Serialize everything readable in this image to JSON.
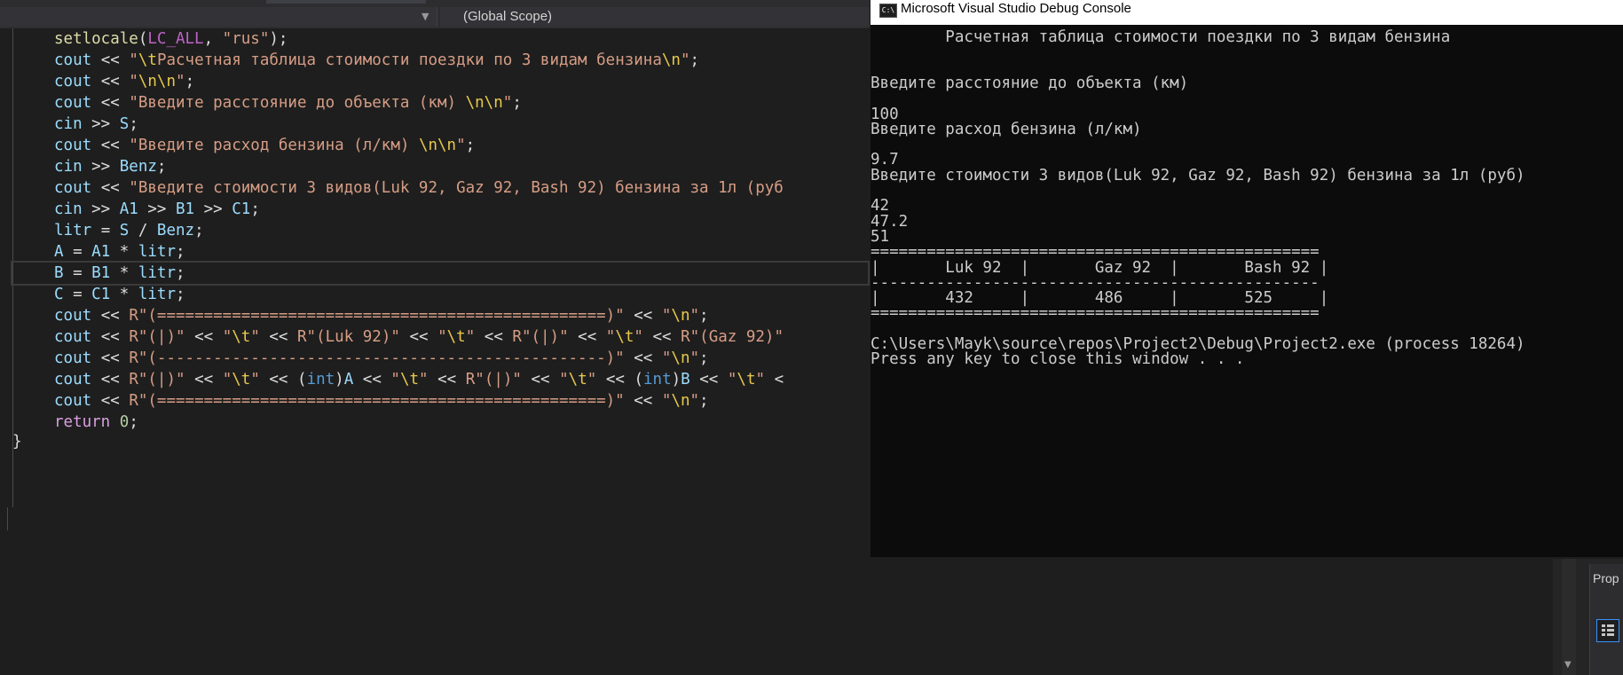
{
  "editor": {
    "navbar": {
      "scope_label": "(Global Scope)"
    },
    "lines": [
      {
        "tokens": [
          {
            "t": "setlocale",
            "c": "fn"
          },
          {
            "t": "("
          },
          {
            "t": "LC_ALL",
            "c": "mac"
          },
          {
            "t": ", "
          },
          {
            "t": "\"rus\"",
            "c": "str"
          },
          {
            "t": ");"
          }
        ]
      },
      {
        "tokens": [
          {
            "t": "cout",
            "c": "var"
          },
          {
            "t": " << "
          },
          {
            "t": "\"",
            "c": "str"
          },
          {
            "t": "\\t",
            "c": "esc"
          },
          {
            "t": "Расчетная таблица стоимости поездки по 3 видам бензина",
            "c": "str"
          },
          {
            "t": "\\n",
            "c": "esc"
          },
          {
            "t": "\"",
            "c": "str"
          },
          {
            "t": ";"
          }
        ]
      },
      {
        "tokens": [
          {
            "t": "cout",
            "c": "var"
          },
          {
            "t": " << "
          },
          {
            "t": "\"",
            "c": "str"
          },
          {
            "t": "\\n\\n",
            "c": "esc"
          },
          {
            "t": "\"",
            "c": "str"
          },
          {
            "t": ";"
          }
        ]
      },
      {
        "tokens": [
          {
            "t": "cout",
            "c": "var"
          },
          {
            "t": " << "
          },
          {
            "t": "\"Введите расстояние до объекта (км) ",
            "c": "str"
          },
          {
            "t": "\\n\\n",
            "c": "esc"
          },
          {
            "t": "\"",
            "c": "str"
          },
          {
            "t": ";"
          }
        ]
      },
      {
        "tokens": [
          {
            "t": "cin",
            "c": "var"
          },
          {
            "t": " >> "
          },
          {
            "t": "S",
            "c": "var"
          },
          {
            "t": ";"
          }
        ]
      },
      {
        "tokens": [
          {
            "t": "cout",
            "c": "var"
          },
          {
            "t": " << "
          },
          {
            "t": "\"Введите расход бензина (л/км) ",
            "c": "str"
          },
          {
            "t": "\\n\\n",
            "c": "esc"
          },
          {
            "t": "\"",
            "c": "str"
          },
          {
            "t": ";"
          }
        ]
      },
      {
        "tokens": [
          {
            "t": "cin",
            "c": "var"
          },
          {
            "t": " >> "
          },
          {
            "t": "Benz",
            "c": "var"
          },
          {
            "t": ";"
          }
        ]
      },
      {
        "tokens": [
          {
            "t": "cout",
            "c": "var"
          },
          {
            "t": " << "
          },
          {
            "t": "\"Введите стоимости 3 видов(Luk 92, Gaz 92, Bash 92) бензина за 1л (руб",
            "c": "str"
          }
        ]
      },
      {
        "tokens": [
          {
            "t": "cin",
            "c": "var"
          },
          {
            "t": " >> "
          },
          {
            "t": "A1",
            "c": "var"
          },
          {
            "t": " >> "
          },
          {
            "t": "B1",
            "c": "var"
          },
          {
            "t": " >> "
          },
          {
            "t": "C1",
            "c": "var"
          },
          {
            "t": ";"
          }
        ]
      },
      {
        "tokens": [
          {
            "t": "litr",
            "c": "var"
          },
          {
            "t": " = "
          },
          {
            "t": "S",
            "c": "var"
          },
          {
            "t": " / "
          },
          {
            "t": "Benz",
            "c": "var"
          },
          {
            "t": ";"
          }
        ]
      },
      {
        "tokens": [
          {
            "t": "A",
            "c": "var"
          },
          {
            "t": " = "
          },
          {
            "t": "A1",
            "c": "var"
          },
          {
            "t": " * "
          },
          {
            "t": "litr",
            "c": "var"
          },
          {
            "t": ";"
          }
        ]
      },
      {
        "current": true,
        "tokens": [
          {
            "t": "B",
            "c": "var"
          },
          {
            "t": " = "
          },
          {
            "t": "B1",
            "c": "var"
          },
          {
            "t": " * "
          },
          {
            "t": "litr",
            "c": "var"
          },
          {
            "t": ";"
          }
        ]
      },
      {
        "tokens": [
          {
            "t": "C",
            "c": "var"
          },
          {
            "t": " = "
          },
          {
            "t": "C1",
            "c": "var"
          },
          {
            "t": " * "
          },
          {
            "t": "litr",
            "c": "var"
          },
          {
            "t": ";"
          }
        ]
      },
      {
        "tokens": [
          {
            "t": "cout",
            "c": "var"
          },
          {
            "t": " << "
          },
          {
            "t": "R\"(================================================)\"",
            "c": "str"
          },
          {
            "t": " << "
          },
          {
            "t": "\"",
            "c": "str"
          },
          {
            "t": "\\n",
            "c": "esc"
          },
          {
            "t": "\"",
            "c": "str"
          },
          {
            "t": ";"
          }
        ]
      },
      {
        "tokens": [
          {
            "t": "cout",
            "c": "var"
          },
          {
            "t": " << "
          },
          {
            "t": "R\"(|)\"",
            "c": "str"
          },
          {
            "t": " << "
          },
          {
            "t": "\"",
            "c": "str"
          },
          {
            "t": "\\t",
            "c": "esc"
          },
          {
            "t": "\"",
            "c": "str"
          },
          {
            "t": " << "
          },
          {
            "t": "R\"(Luk 92)\"",
            "c": "str"
          },
          {
            "t": " << "
          },
          {
            "t": "\"",
            "c": "str"
          },
          {
            "t": "\\t",
            "c": "esc"
          },
          {
            "t": "\"",
            "c": "str"
          },
          {
            "t": " << "
          },
          {
            "t": "R\"(|)\"",
            "c": "str"
          },
          {
            "t": " << "
          },
          {
            "t": "\"",
            "c": "str"
          },
          {
            "t": "\\t",
            "c": "esc"
          },
          {
            "t": "\"",
            "c": "str"
          },
          {
            "t": " << "
          },
          {
            "t": "R\"(Gaz 92)\"",
            "c": "str"
          }
        ]
      },
      {
        "tokens": [
          {
            "t": "cout",
            "c": "var"
          },
          {
            "t": " << "
          },
          {
            "t": "R\"(------------------------------------------------)\"",
            "c": "str"
          },
          {
            "t": " << "
          },
          {
            "t": "\"",
            "c": "str"
          },
          {
            "t": "\\n",
            "c": "esc"
          },
          {
            "t": "\"",
            "c": "str"
          },
          {
            "t": ";"
          }
        ]
      },
      {
        "tokens": [
          {
            "t": "cout",
            "c": "var"
          },
          {
            "t": " << "
          },
          {
            "t": "R\"(|)\"",
            "c": "str"
          },
          {
            "t": " << "
          },
          {
            "t": "\"",
            "c": "str"
          },
          {
            "t": "\\t",
            "c": "esc"
          },
          {
            "t": "\"",
            "c": "str"
          },
          {
            "t": " << "
          },
          {
            "t": "("
          },
          {
            "t": "int",
            "c": "ty"
          },
          {
            "t": ")"
          },
          {
            "t": "A",
            "c": "var"
          },
          {
            "t": " << "
          },
          {
            "t": "\"",
            "c": "str"
          },
          {
            "t": "\\t",
            "c": "esc"
          },
          {
            "t": "\"",
            "c": "str"
          },
          {
            "t": " << "
          },
          {
            "t": "R\"(|)\"",
            "c": "str"
          },
          {
            "t": " << "
          },
          {
            "t": "\"",
            "c": "str"
          },
          {
            "t": "\\t",
            "c": "esc"
          },
          {
            "t": "\"",
            "c": "str"
          },
          {
            "t": " << "
          },
          {
            "t": "("
          },
          {
            "t": "int",
            "c": "ty"
          },
          {
            "t": ")"
          },
          {
            "t": "B",
            "c": "var"
          },
          {
            "t": " << "
          },
          {
            "t": "\"",
            "c": "str"
          },
          {
            "t": "\\t",
            "c": "esc"
          },
          {
            "t": "\"",
            "c": "str"
          },
          {
            "t": " <"
          }
        ]
      },
      {
        "tokens": [
          {
            "t": "cout",
            "c": "var"
          },
          {
            "t": " << "
          },
          {
            "t": "R\"(================================================)\"",
            "c": "str"
          },
          {
            "t": " << "
          },
          {
            "t": "\"",
            "c": "str"
          },
          {
            "t": "\\n",
            "c": "esc"
          },
          {
            "t": "\"",
            "c": "str"
          },
          {
            "t": ";"
          }
        ]
      },
      {
        "tokens": [
          {
            "t": "return",
            "c": "kw"
          },
          {
            "t": " "
          },
          {
            "t": "0",
            "c": "num"
          },
          {
            "t": ";"
          }
        ]
      }
    ],
    "closing_brace": "}"
  },
  "console": {
    "title": "Microsoft Visual Studio Debug Console",
    "icon_text": "C:\\",
    "lines": [
      "        Расчетная таблица стоимости поездки по 3 видам бензина",
      "",
      "",
      "Введите расстояние до объекта (км)",
      "",
      "100",
      "Введите расход бензина (л/км)",
      "",
      "9.7",
      "Введите стоимости 3 видов(Luk 92, Gaz 92, Bash 92) бензина за 1л (руб)",
      "",
      "42",
      "47.2",
      "51",
      "================================================",
      "|       Luk 92  |       Gaz 92  |       Bash 92 |",
      "------------------------------------------------",
      "|       432     |       486     |       525     |",
      "================================================",
      "",
      "C:\\Users\\Mayk\\source\\repos\\Project2\\Debug\\Project2.exe (process 18264)",
      "Press any key to close this window . . ."
    ]
  },
  "side_panel": {
    "properties_label": "Prop"
  }
}
